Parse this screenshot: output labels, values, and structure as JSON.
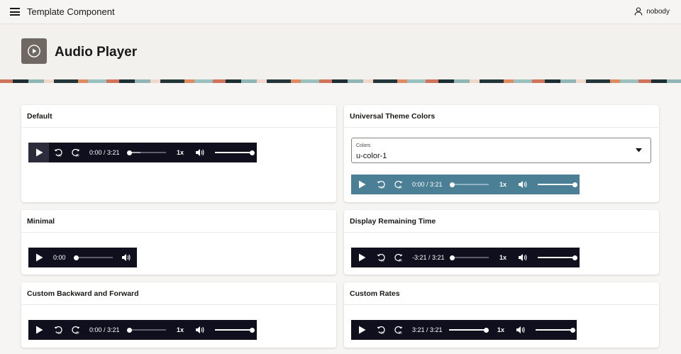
{
  "header": {
    "menu_icon": "hamburger-icon",
    "app_title": "Template Component",
    "user_icon": "user-icon",
    "username": "nobody"
  },
  "hero": {
    "icon": "play-circle-icon",
    "title": "Audio Player"
  },
  "colors": {
    "player_dark": "#0f0f1e",
    "player_theme": "#4a7f95",
    "hero_icon_bg": "#6f6762"
  },
  "cards": {
    "default": {
      "title": "Default",
      "time": "0:00 / 3:21",
      "rate": "1x",
      "progress": 0.0,
      "buffered": 0.3,
      "volume": 1.0
    },
    "universal_theme": {
      "title": "Universal Theme Colors",
      "select_label": "Colors",
      "select_value": "u-color-1",
      "time": "0:00 / 3:21",
      "rate": "1x",
      "progress": 0.0,
      "volume": 1.0
    },
    "minimal": {
      "title": "Minimal",
      "time": "0:00",
      "progress": 0.0
    },
    "remaining": {
      "title": "Display Remaining Time",
      "time": "-3:21 / 3:21",
      "rate": "1x",
      "progress": 0.0,
      "volume": 1.0
    },
    "custom_skip": {
      "title": "Custom Backward and Forward",
      "time": "0:00 / 3:21",
      "rate": "1x",
      "progress": 0.0,
      "volume": 1.0
    },
    "custom_rates": {
      "title": "Custom Rates",
      "time": "3:21 / 3:21",
      "rate": "1x",
      "progress": 1.0,
      "volume": 1.0
    }
  },
  "icons": {
    "play": "play-icon",
    "rewind": "rewind-icon",
    "forward": "forward-icon",
    "volume": "volume-icon",
    "select_caret": "caret-down-icon",
    "rewind_label": "30",
    "forward_label": "30",
    "rewind_label_custom": "10",
    "forward_label_custom": "10"
  }
}
